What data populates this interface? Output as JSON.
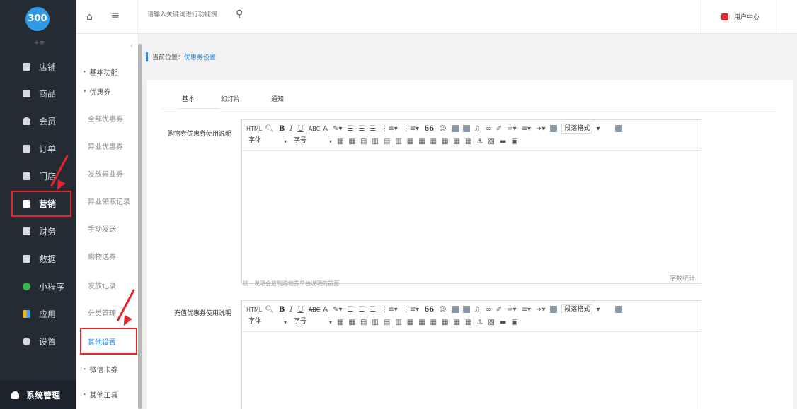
{
  "app": {
    "logo_text": "300"
  },
  "topbar": {
    "search_placeholder": "请输入关键词进行功能搜",
    "user_center": "用户中心"
  },
  "sidebar": {
    "items": [
      {
        "label": "店铺",
        "icon": "shop-icon"
      },
      {
        "label": "商品",
        "icon": "goods-icon"
      },
      {
        "label": "会员",
        "icon": "member-icon"
      },
      {
        "label": "订单",
        "icon": "order-icon"
      },
      {
        "label": "门店",
        "icon": "store-icon"
      },
      {
        "label": "营销",
        "icon": "gift-icon"
      },
      {
        "label": "财务",
        "icon": "finance-icon"
      },
      {
        "label": "数据",
        "icon": "chart-icon"
      },
      {
        "label": "小程序",
        "icon": "miniprogram-icon"
      },
      {
        "label": "应用",
        "icon": "apps-icon"
      },
      {
        "label": "设置",
        "icon": "gear-icon"
      }
    ],
    "system": "系统管理"
  },
  "submenu": {
    "items": [
      {
        "label": "基本功能",
        "type": "group"
      },
      {
        "label": "优惠券",
        "type": "group-open"
      },
      {
        "label": "全部优惠券"
      },
      {
        "label": "异业优惠券"
      },
      {
        "label": "发放异业券"
      },
      {
        "label": "异业领取记录"
      },
      {
        "label": "手动发送"
      },
      {
        "label": "购物送券"
      },
      {
        "label": "发放记录"
      },
      {
        "label": "分类管理"
      },
      {
        "label": "其他设置"
      },
      {
        "label": "微信卡券",
        "type": "group"
      },
      {
        "label": "其他工具",
        "type": "group"
      }
    ]
  },
  "breadcrumb": {
    "prefix": "当前位置：",
    "current": "优惠券设置"
  },
  "tabs": [
    "基本",
    "幻灯片",
    "通知"
  ],
  "editors": [
    {
      "label": "购物券优惠券使用说明",
      "counter": "字数统计",
      "help": "统一说明会放到购物券单独说明的前面"
    },
    {
      "label": "充值优惠券使用说明"
    }
  ],
  "toolbar": {
    "html": "HTML",
    "bold": "B",
    "italic": "I",
    "underline": "U",
    "strike": "ABC",
    "fontcolor": "A",
    "quote": "66",
    "paragraph": "段落格式",
    "font": "字体",
    "size": "字号"
  },
  "colors": {
    "sidebar": "#242b33",
    "accent": "#2f86d9",
    "highlight": "#e0262b"
  }
}
